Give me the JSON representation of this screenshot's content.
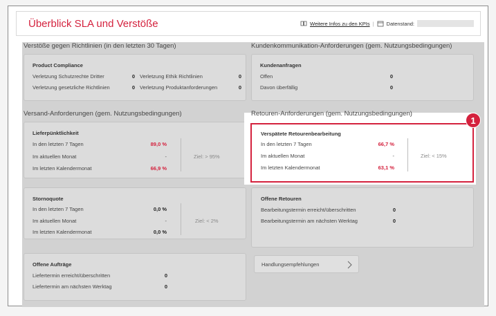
{
  "header": {
    "title": "Überblick SLA und Verstöße",
    "kpi_link": "Weitere Infos zu den KPIs",
    "date_label": "Datenstand:"
  },
  "violations": {
    "section": "Verstöße gegen Richtlinien (in den letzten 30 Tagen)",
    "card_title": "Product Compliance",
    "rows_left": [
      {
        "label": "Verletzung Schutzrechte Dritter",
        "value": "0"
      },
      {
        "label": "Verletzung gesetzliche Richtlinien",
        "value": "0"
      }
    ],
    "rows_right": [
      {
        "label": "Verletzung Ethik Richtlinien",
        "value": "0"
      },
      {
        "label": "Verletzung Produktanforderungen",
        "value": "0"
      }
    ]
  },
  "customer": {
    "section": "Kundenkommunikation-Anforderungen (gem. Nutzungsbedingungen)",
    "card_title": "Kundenanfragen",
    "rows": [
      {
        "label": "Offen",
        "value": "0"
      },
      {
        "label": "Davon überfällig",
        "value": "0"
      }
    ]
  },
  "shipping": {
    "section": "Versand-Anforderungen (gem. Nutzungsbedingungen)",
    "delivery": {
      "title": "Lieferpünktlichkeit",
      "rows": [
        {
          "label": "In den letzten 7 Tagen",
          "value": "89,0 %"
        },
        {
          "label": "Im aktuellen Monat",
          "value": "-"
        },
        {
          "label": "Im letzten Kalendermonat",
          "value": "66,9 %"
        }
      ],
      "goal": "Ziel: > 95%"
    },
    "cancel": {
      "title": "Stornoquote",
      "rows": [
        {
          "label": "In den letzten 7 Tagen",
          "value": "0,0 %"
        },
        {
          "label": "Im aktuellen Monat",
          "value": "-"
        },
        {
          "label": "Im letzten Kalendermonat",
          "value": "0,0 %"
        }
      ],
      "goal": "Ziel: < 2%"
    },
    "orders": {
      "title": "Offene Aufträge",
      "rows": [
        {
          "label": "Liefertermin erreicht/überschritten",
          "value": "0"
        },
        {
          "label": "Liefertermin am nächsten Werktag",
          "value": "0"
        }
      ]
    }
  },
  "returns": {
    "section": "Retouren-Anforderungen (gem. Nutzungsbedingungen)",
    "late": {
      "title": "Verspätete Retourenbearbeitung",
      "rows": [
        {
          "label": "In den letzten 7 Tagen",
          "value": "66,7 %"
        },
        {
          "label": "Im aktuellen Monat",
          "value": "-"
        },
        {
          "label": "Im letzten Kalendermonat",
          "value": "63,1 %"
        }
      ],
      "goal": "Ziel: < 15%"
    },
    "open": {
      "title": "Offene Retouren",
      "rows": [
        {
          "label": "Bearbeitungstermin erreicht/überschritten",
          "value": "0"
        },
        {
          "label": "Bearbeitungstermin am nächsten Werktag",
          "value": "0"
        }
      ]
    },
    "badge": "1",
    "button_label": "Handlungsempfehlungen"
  },
  "colors": {
    "accent": "#d4213d",
    "panel": "#d2d2d2",
    "card": "#dcdcdc"
  }
}
